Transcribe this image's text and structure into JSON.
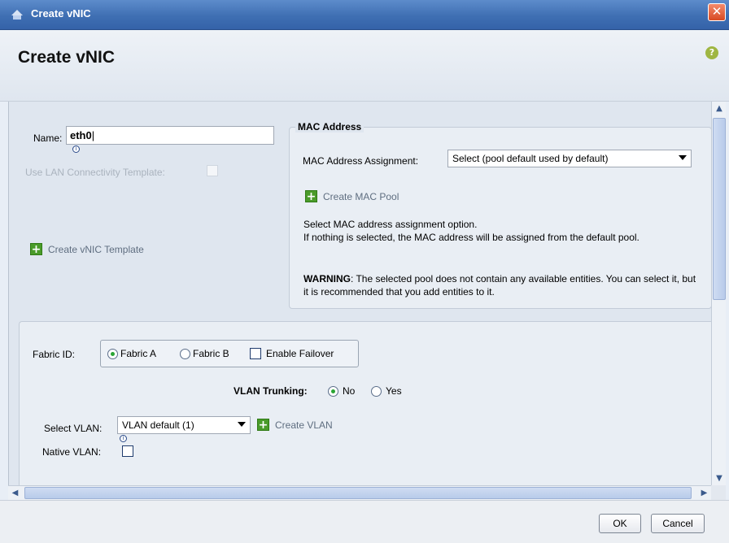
{
  "window": {
    "title": "Create vNIC",
    "close_symbol": "✕"
  },
  "header": {
    "title": "Create vNIC",
    "help_symbol": "?"
  },
  "form": {
    "name_label": "Name:",
    "name_value": "eth0",
    "use_template_label": "Use LAN Connectivity Template:",
    "create_template_link": "Create vNIC Template"
  },
  "mac": {
    "group_title": "MAC Address",
    "assignment_label": "MAC Address Assignment:",
    "assignment_value": "Select (pool default used by default)",
    "create_pool_link": "Create MAC Pool",
    "help_line1": "Select MAC address assignment option.",
    "help_line2": "If nothing is selected, the MAC address will be assigned from the default pool.",
    "warning_label": "WARNING",
    "warning_text": ": The selected pool does not contain any available entities. You can select it, but it is recommended that you add entities to it."
  },
  "fabric": {
    "label": "Fabric ID:",
    "option_a": "Fabric A",
    "option_b": "Fabric B",
    "failover_label": "Enable Failover",
    "selected": "Fabric A"
  },
  "vlan": {
    "trunking_label": "VLAN Trunking:",
    "trunking_no": "No",
    "trunking_yes": "Yes",
    "trunking_selected": "No",
    "select_label": "Select VLAN:",
    "select_value": "VLAN default (1)",
    "create_link": "Create VLAN",
    "native_label": "Native VLAN:"
  },
  "icons": {
    "info": "i",
    "plus": "+"
  },
  "footer": {
    "ok_label": "OK",
    "cancel_label": "Cancel"
  },
  "scroll": {
    "up": "▲",
    "down": "▼",
    "left": "◀",
    "right": "▶"
  }
}
